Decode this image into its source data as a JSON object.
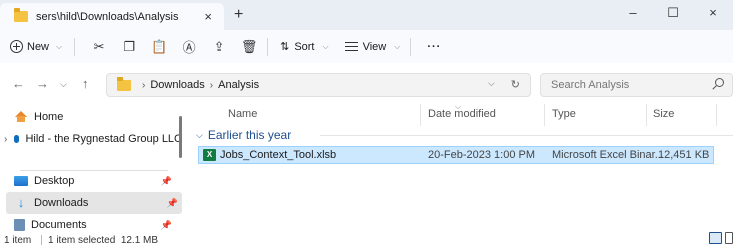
{
  "tab": {
    "title": "sers\\hild\\Downloads\\Analysis",
    "close": "×",
    "new": "+"
  },
  "window": {
    "minimize": "–",
    "maximize": "☐",
    "close": "×"
  },
  "toolbar": {
    "new_label": "New",
    "sort_label": "Sort",
    "view_label": "View",
    "more_label": "···"
  },
  "address": {
    "breadcrumbs": [
      "Downloads",
      "Analysis"
    ],
    "search_placeholder": "Search Analysis"
  },
  "nav": {
    "items": [
      {
        "label": "Home",
        "icon": "home-icon"
      },
      {
        "label": "Hild - the Rygnestad Group LLC",
        "icon": "cloud-icon"
      },
      {
        "label": "Desktop",
        "icon": "desktop-icon"
      },
      {
        "label": "Downloads",
        "icon": "download-icon"
      },
      {
        "label": "Documents",
        "icon": "documents-icon"
      }
    ]
  },
  "list": {
    "columns": [
      "Name",
      "Date modified",
      "Type",
      "Size"
    ],
    "group": "Earlier this year",
    "files": [
      {
        "name": "Jobs_Context_Tool.xlsb",
        "date": "20-Feb-2023 1:00 PM",
        "type": "Microsoft Excel Binar...",
        "size": "12,451 KB"
      }
    ]
  },
  "status": {
    "count": "1 item",
    "selection": "1 item selected  12.1 MB"
  },
  "colors": {
    "accent": "#0f6cbd",
    "selection": "#cce8ff",
    "excel": "#107c41",
    "folder": "#f5c342"
  }
}
